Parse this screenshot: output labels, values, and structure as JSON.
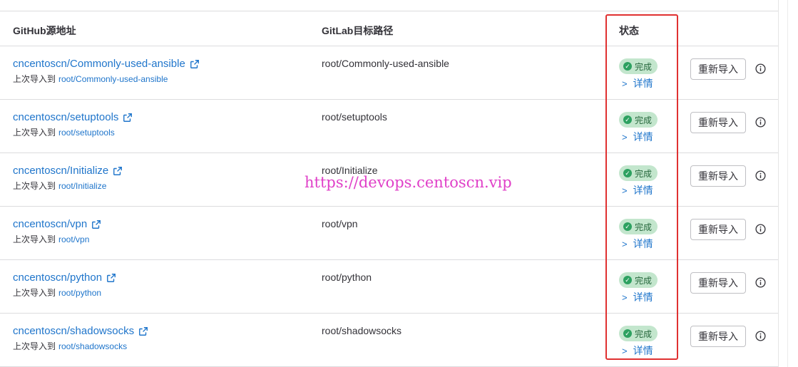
{
  "header": {
    "col_source": "GitHub源地址",
    "col_target": "GitLab目标路径",
    "col_status": "状态"
  },
  "rows": [
    {
      "source": "cncentoscn/Commonly-used-ansible",
      "last_import_prefix": "上次导入到",
      "last_import_target": "root/Commonly-used-ansible",
      "target": "root/Commonly-used-ansible",
      "status": "完成",
      "details": "详情",
      "reimport": "重新导入"
    },
    {
      "source": "cncentoscn/setuptools",
      "last_import_prefix": "上次导入到",
      "last_import_target": "root/setuptools",
      "target": "root/setuptools",
      "status": "完成",
      "details": "详情",
      "reimport": "重新导入"
    },
    {
      "source": "cncentoscn/Initialize",
      "last_import_prefix": "上次导入到",
      "last_import_target": "root/Initialize",
      "target": "root/Initialize",
      "status": "完成",
      "details": "详情",
      "reimport": "重新导入"
    },
    {
      "source": "cncentoscn/vpn",
      "last_import_prefix": "上次导入到",
      "last_import_target": "root/vpn",
      "target": "root/vpn",
      "status": "完成",
      "details": "详情",
      "reimport": "重新导入"
    },
    {
      "source": "cncentoscn/python",
      "last_import_prefix": "上次导入到",
      "last_import_target": "root/python",
      "target": "root/python",
      "status": "完成",
      "details": "详情",
      "reimport": "重新导入"
    },
    {
      "source": "cncentoscn/shadowsocks",
      "last_import_prefix": "上次导入到",
      "last_import_target": "root/shadowsocks",
      "target": "root/shadowsocks",
      "status": "完成",
      "details": "详情",
      "reimport": "重新导入"
    }
  ],
  "watermark": "https://devops.centoscn.vip",
  "colors": {
    "link": "#1f75cb",
    "success_bg": "#c3e6cd",
    "success_text": "#24663b",
    "highlight": "#e03131",
    "watermark": "#e040c8"
  },
  "icons": {
    "external": "external-link-icon",
    "check": "check-circle-icon",
    "chevron": "chevron-right-icon",
    "info": "info-icon"
  }
}
